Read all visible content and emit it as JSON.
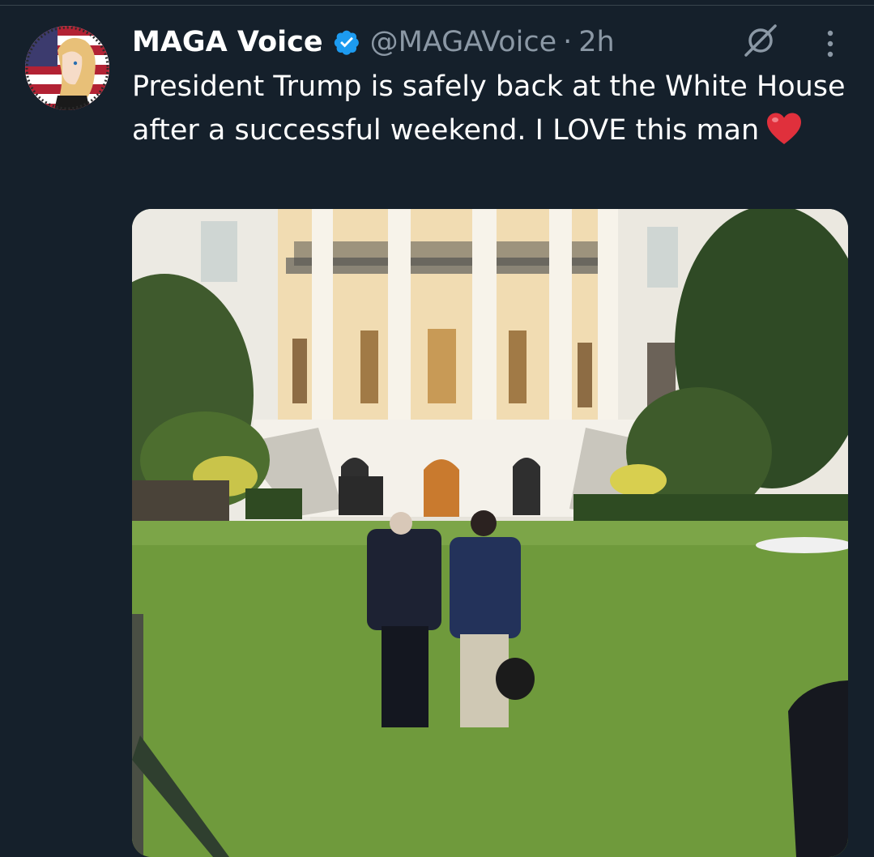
{
  "tweet": {
    "display_name": "MAGA Voice",
    "handle": "@MAGAVoice",
    "separator": "·",
    "time": "2h",
    "text": "President Trump is safely back at the White House after a successful weekend. I LOVE this man",
    "emoji_icon": "red-heart-emoji",
    "verified_icon": "verified-badge-icon",
    "grok_icon": "grok-icon",
    "more_icon": "more-options-icon"
  },
  "colors": {
    "background": "#15202b",
    "secondary_text": "#8b98a5",
    "verified_blue": "#1d9bf0",
    "heart_red": "#f91880"
  }
}
